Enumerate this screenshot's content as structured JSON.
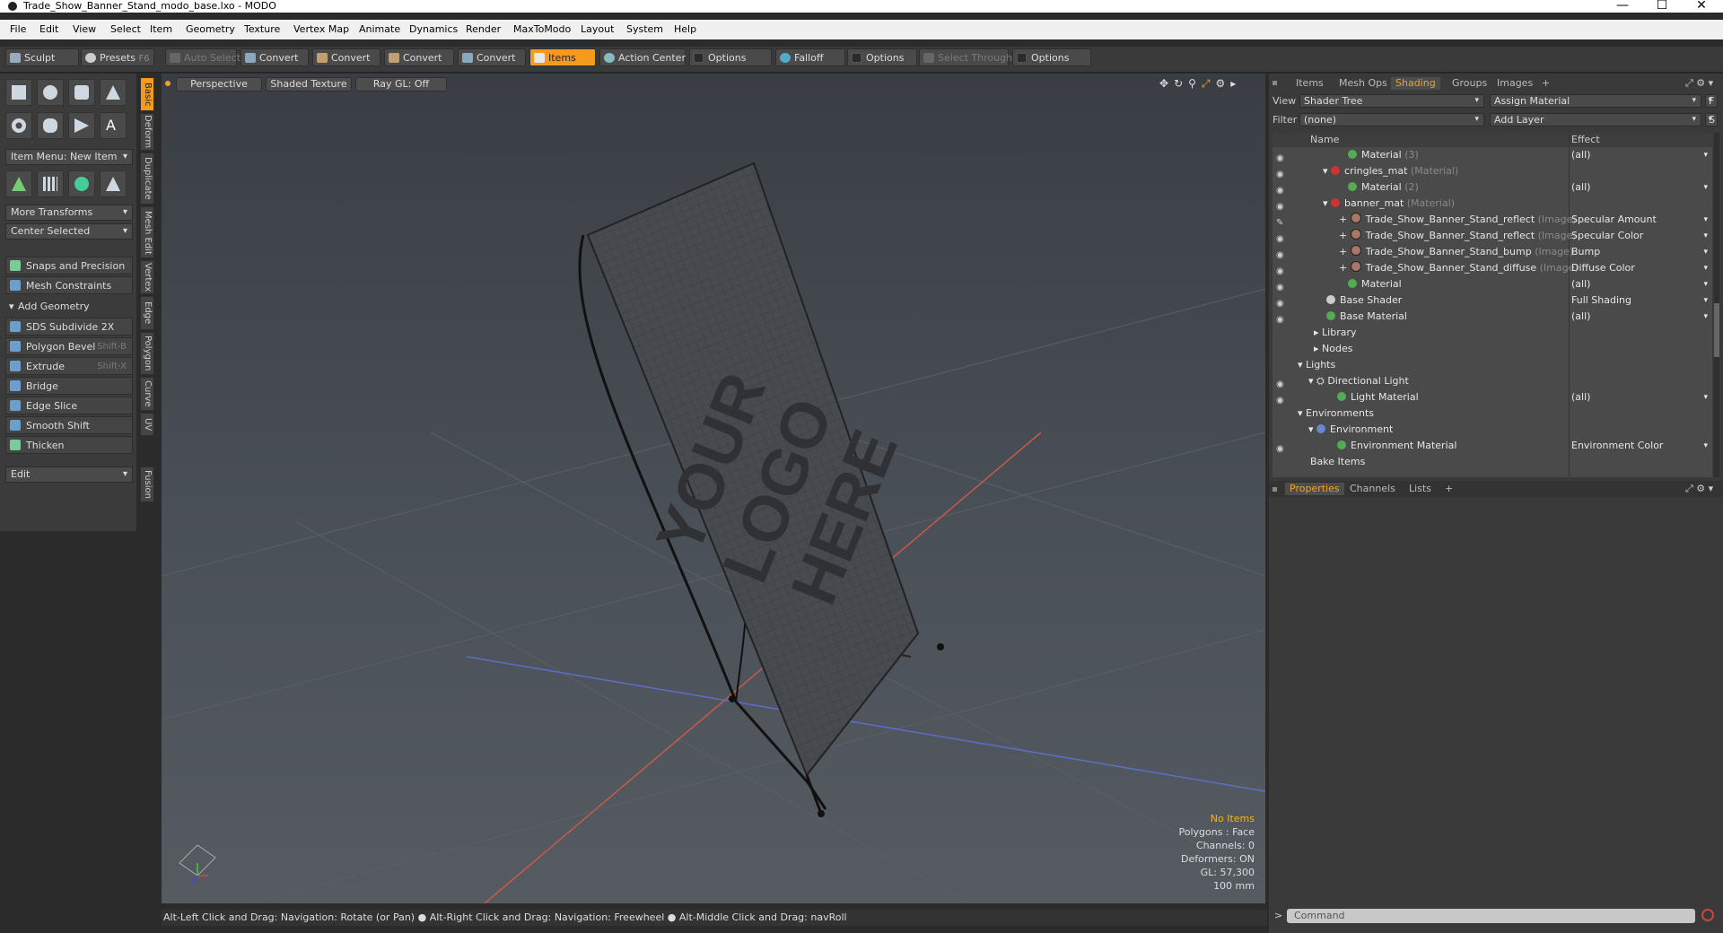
{
  "window": {
    "title": "Trade_Show_Banner_Stand_modo_base.lxo - MODO",
    "min": "—",
    "max": "☐",
    "close": "✕"
  },
  "menu": [
    "File",
    "Edit",
    "View",
    "Select",
    "Item",
    "Geometry",
    "Texture",
    "Vertex Map",
    "Animate",
    "Dynamics",
    "Render",
    "MaxToModo",
    "Layout",
    "System",
    "Help"
  ],
  "toolbar": {
    "sculpt": "Sculpt",
    "presets": "Presets",
    "presets_key": "F6",
    "auto_select": "Auto Select",
    "convert": "Convert",
    "items": "Items",
    "action_center": "Action Center",
    "options": "Options",
    "falloff": "Falloff",
    "select_through": "Select Through"
  },
  "left": {
    "item_menu": "Item Menu: New Item",
    "more_transforms": "More Transforms",
    "center_selected": "Center Selected",
    "snaps": "Snaps and Precision",
    "mesh_constraints": "Mesh Constraints",
    "add_geometry": "Add Geometry",
    "tools": [
      {
        "label": "SDS Subdivide 2X",
        "key": ""
      },
      {
        "label": "Polygon Bevel",
        "key": "Shift-B"
      },
      {
        "label": "Extrude",
        "key": "Shift-X"
      },
      {
        "label": "Bridge",
        "key": ""
      },
      {
        "label": "Edge Slice",
        "key": ""
      },
      {
        "label": "Smooth Shift",
        "key": ""
      },
      {
        "label": "Thicken",
        "key": ""
      }
    ],
    "edit": "Edit",
    "vtabs": [
      "Basic",
      "Deform",
      "Duplicate",
      "Mesh Edit",
      "Vertex",
      "Edge",
      "Polygon",
      "Curve",
      "UV",
      "Fusion"
    ]
  },
  "viewport": {
    "perspective": "Perspective",
    "shaded_texture": "Shaded Texture",
    "ray_gl": "Ray GL: Off",
    "banner_text": [
      "YOUR",
      "LOGO",
      "HERE"
    ],
    "info": {
      "no_items": "No Items",
      "polygons": "Polygons : Face",
      "channels": "Channels: 0",
      "deformers": "Deformers: ON",
      "gl": "GL: 57,300",
      "scale": "100 mm"
    }
  },
  "status": "Alt-Left Click and Drag: Navigation: Rotate (or Pan) ● Alt-Right Click and Drag: Navigation: Freewheel ● Alt-Middle Click and Drag: navRoll",
  "right": {
    "tabs": [
      "Items",
      "Mesh Ops",
      "Shading",
      "Groups",
      "Images",
      "+"
    ],
    "view_label": "View",
    "view_value": "Shader Tree",
    "assign": "Assign Material",
    "assign_btn": "F",
    "filter_label": "Filter",
    "filter_value": "(none)",
    "add_layer": "Add Layer",
    "add_layer_btn": "S",
    "col_name": "Name",
    "col_effect": "Effect",
    "rows": [
      {
        "name": "Material",
        "sub": "(3)",
        "effect": "(all)"
      },
      {
        "name": "cringles_mat",
        "sub": "(Material)",
        "effect": ""
      },
      {
        "name": "Material",
        "sub": "(2)",
        "effect": "(all)"
      },
      {
        "name": "banner_mat",
        "sub": "(Material)",
        "effect": ""
      },
      {
        "name": "Trade_Show_Banner_Stand_reflect",
        "sub": "(Image) ...",
        "effect": "Specular Amount"
      },
      {
        "name": "Trade_Show_Banner_Stand_reflect",
        "sub": "(Image)",
        "effect": "Specular Color"
      },
      {
        "name": "Trade_Show_Banner_Stand_bump",
        "sub": "(Image)",
        "effect": "Bump"
      },
      {
        "name": "Trade_Show_Banner_Stand_diffuse",
        "sub": "(Image)",
        "effect": "Diffuse Color"
      },
      {
        "name": "Material",
        "sub": "",
        "effect": "(all)"
      },
      {
        "name": "Base Shader",
        "sub": "",
        "effect": "Full Shading"
      },
      {
        "name": "Base Material",
        "sub": "",
        "effect": "(all)"
      },
      {
        "name": "Library",
        "sub": "",
        "effect": ""
      },
      {
        "name": "Nodes",
        "sub": "",
        "effect": ""
      },
      {
        "name": "Lights",
        "sub": "",
        "effect": ""
      },
      {
        "name": "Directional Light",
        "sub": "",
        "effect": ""
      },
      {
        "name": "Light Material",
        "sub": "",
        "effect": "(all)"
      },
      {
        "name": "Environments",
        "sub": "",
        "effect": ""
      },
      {
        "name": "Environment",
        "sub": "",
        "effect": ""
      },
      {
        "name": "Environment Material",
        "sub": "",
        "effect": "Environment Color"
      },
      {
        "name": "Bake Items",
        "sub": "",
        "effect": ""
      }
    ],
    "bottom_tabs": [
      "Properties",
      "Channels",
      "Lists",
      "+"
    ],
    "command_placeholder": "Command"
  },
  "colors": {
    "accent": "#f59a1c",
    "viewport_bg": "#4a5057"
  }
}
